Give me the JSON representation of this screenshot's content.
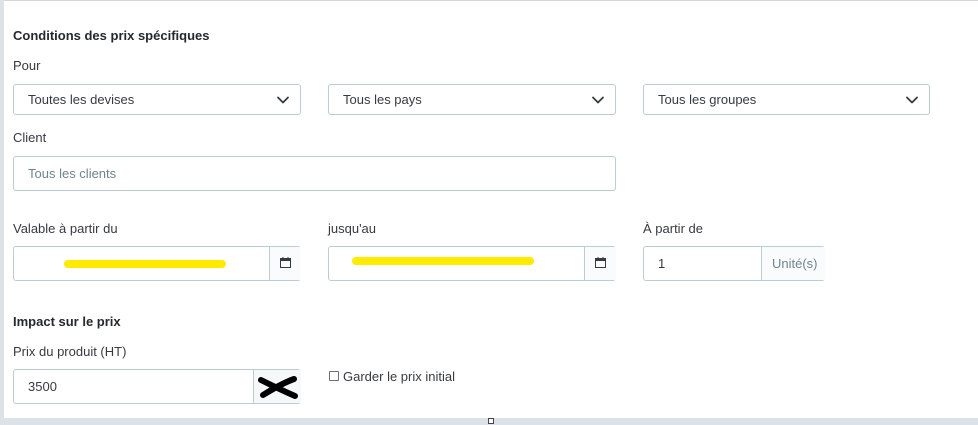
{
  "conditions": {
    "title": "Conditions des prix spécifiques",
    "pour_label": "Pour",
    "currency_select": "Toutes les devises",
    "country_select": "Tous les pays",
    "group_select": "Tous les groupes",
    "client_label": "Client",
    "client_placeholder": "Tous les clients",
    "from_label": "Valable à partir du",
    "to_label": "jusqu'au",
    "starting_at_label": "À partir de",
    "starting_at_value": "1",
    "unit_suffix": "Unité(s)"
  },
  "impact": {
    "title": "Impact sur le prix",
    "price_label": "Prix du produit (HT)",
    "price_value": "3500",
    "keep_initial_label": "Garder le prix initial"
  },
  "colors": {
    "border": "#bbcdd2",
    "highlight": "#ffeb00",
    "text": "#363a41"
  },
  "icons": [
    "chevron-down-icon",
    "calendar-icon",
    "checkbox-icon"
  ]
}
